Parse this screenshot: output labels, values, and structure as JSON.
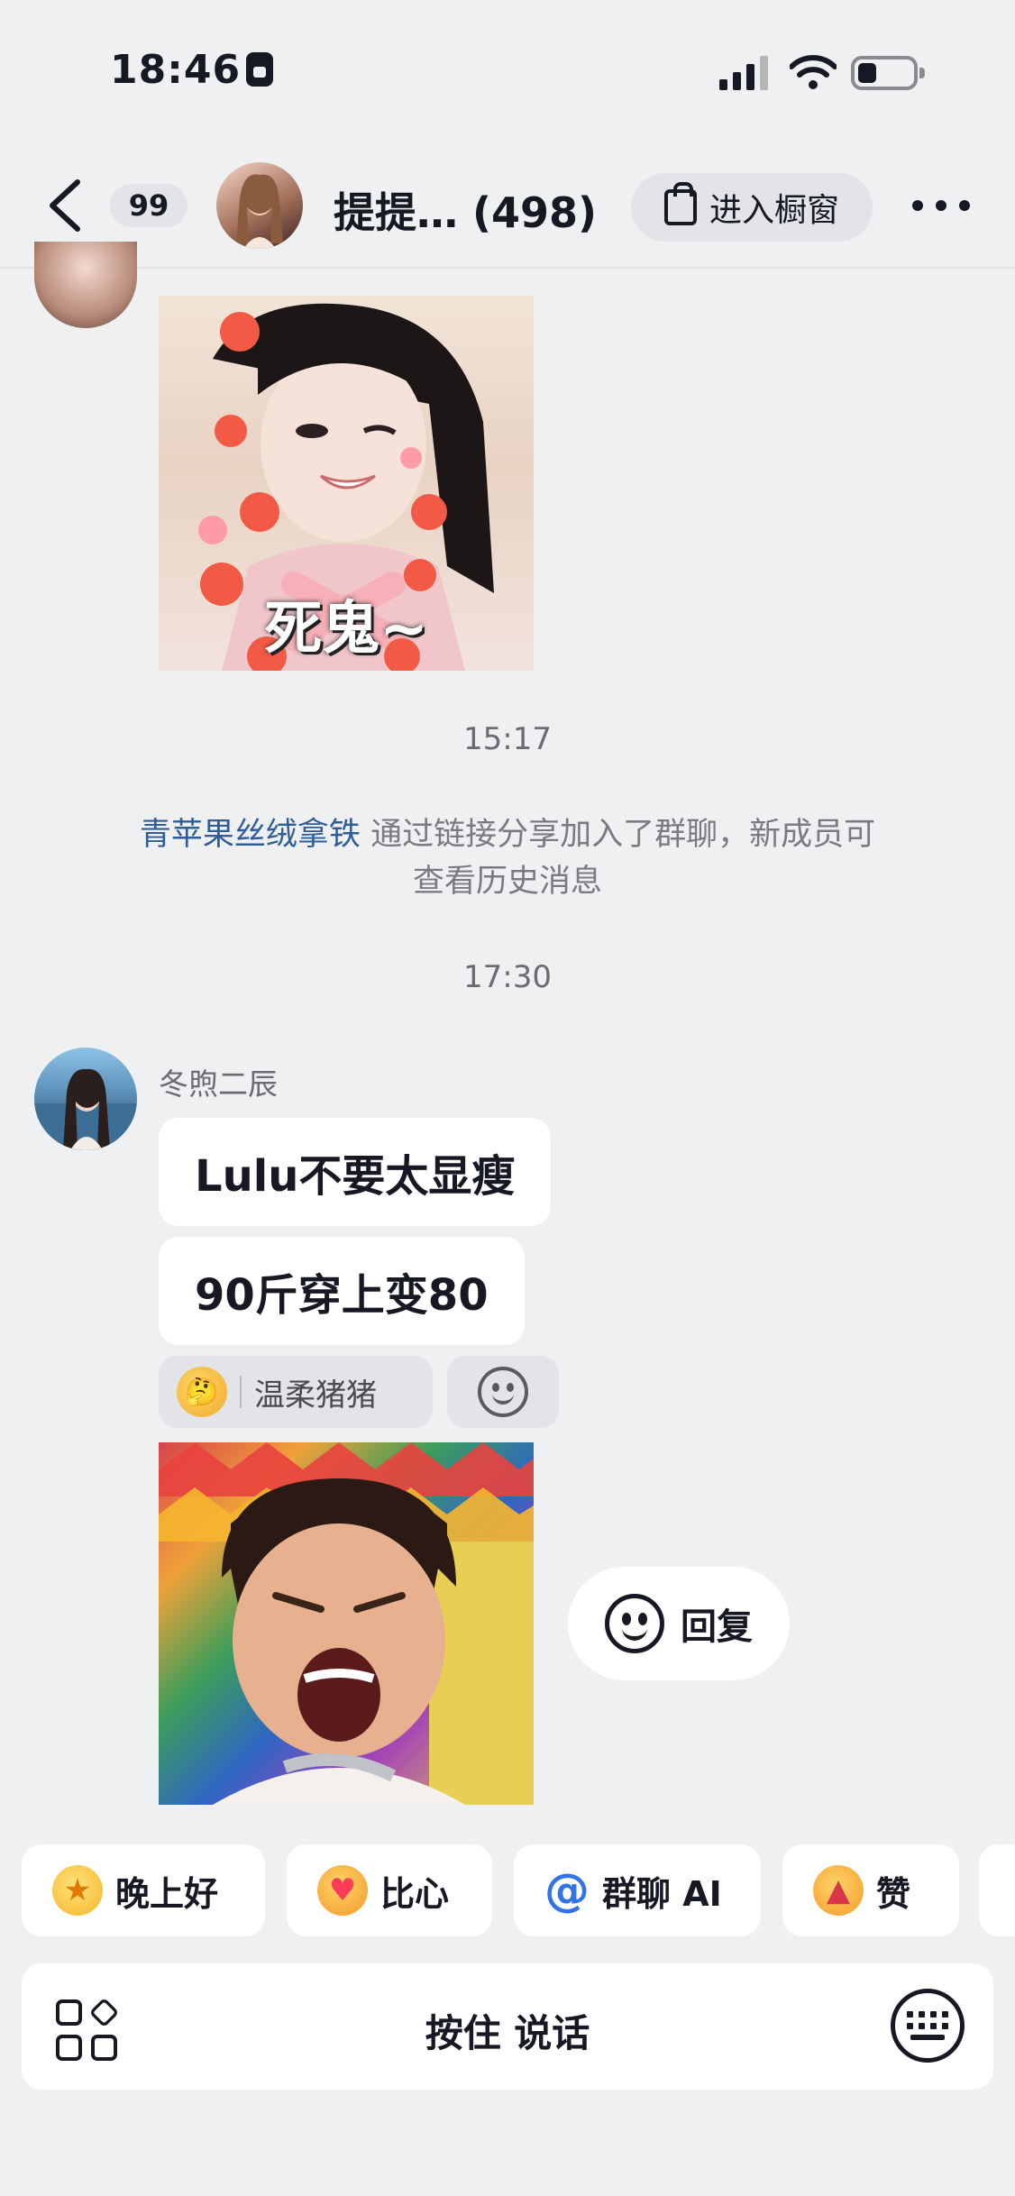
{
  "status_bar": {
    "time": "18:46"
  },
  "header": {
    "unread_count": "99",
    "group_name": "提提…",
    "member_count": "(498)",
    "showcase_label": "进入橱窗"
  },
  "messages": {
    "sticker_1_caption": "死鬼~",
    "time_1": "15:17",
    "system_message": {
      "user": "青苹果丝绒拿铁",
      "text": " 通过链接分享加入了群聊，新成员可查看历史消息"
    },
    "time_2": "17:30",
    "sender_name": "冬煦二辰",
    "bubble_1": "Lulu不要太显瘦",
    "bubble_2": "90斤穿上变80",
    "reaction": {
      "emoji": "🤔",
      "user": "温柔猪猪"
    },
    "reply_label": "回复"
  },
  "quick_replies": [
    {
      "icon": "star-face-icon",
      "label": "晚上好"
    },
    {
      "icon": "finger-heart-icon",
      "label": "比心"
    },
    {
      "icon": "at-icon",
      "label": "群聊 AI"
    },
    {
      "icon": "thumbs-up-icon",
      "label": "赞"
    }
  ],
  "input_bar": {
    "hold_to_talk": "按住 说话"
  }
}
